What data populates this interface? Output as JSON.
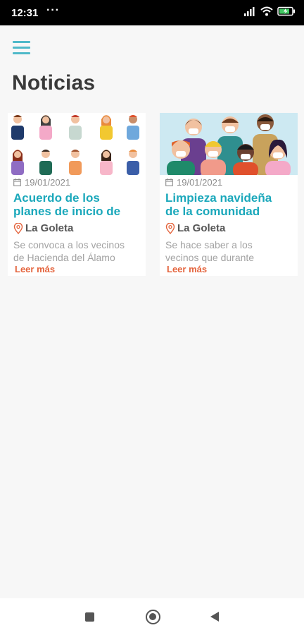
{
  "status_bar": {
    "time": "12:31",
    "dots": "···"
  },
  "header": {
    "title": "Noticias"
  },
  "news": [
    {
      "date": "19/01/2021",
      "title_line1": "Acuerdo de los",
      "title_line2": "planes de inicio de",
      "location": "La Goleta",
      "excerpt_line1": "Se convoca a los vecinos",
      "excerpt_line2": "de Hacienda del Álamo",
      "link": "Leer más",
      "image": "crowd-illustration-grid"
    },
    {
      "date": "19/01/2021",
      "title_line1": "Limpieza navideña",
      "title_line2": "de la comunidad",
      "location": "La Goleta",
      "excerpt_line1": "Se hace saber a los",
      "excerpt_line2": "vecinos que durante",
      "link": "Leer más",
      "image": "crowd-with-masks"
    }
  ],
  "colors": {
    "accent": "#1ba8bb",
    "link": "#e4633c",
    "menu": "#4fb9c9",
    "title": "#3a3a3a"
  },
  "icons": [
    "menu-icon",
    "calendar-icon",
    "location-pin-icon",
    "signal-icon",
    "wifi-icon",
    "battery-icon",
    "recents-icon",
    "home-icon",
    "back-icon"
  ]
}
